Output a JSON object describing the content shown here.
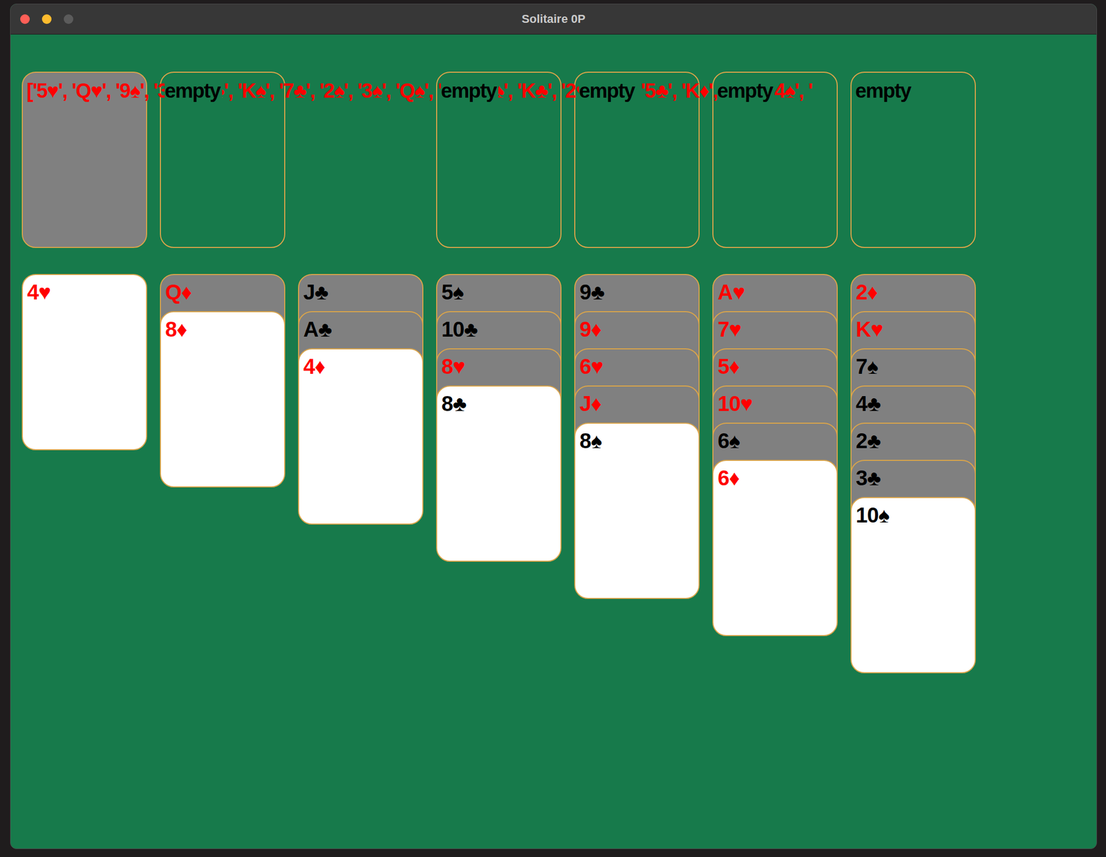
{
  "window": {
    "title": "Solitaire 0P",
    "controls": [
      {
        "name": "close",
        "color": "#ff5f57"
      },
      {
        "name": "minimize",
        "color": "#febc2e"
      },
      {
        "name": "zoom",
        "color": "#5b5b5b"
      }
    ]
  },
  "top_row": [
    {
      "kind": "stock",
      "label": "['5♥', 'Q♥', '9♠', '3♥', 'Q♣', 'K♠', '7♣', '2♠', '3♠', 'Q♠', 'J♠', 'A♠', 'K♣', '2♥', '6♣', '5♣', 'K♦', '10♦', '4♠', '"
    },
    {
      "kind": "slot",
      "label": "empty"
    },
    {
      "kind": "blank",
      "label": ""
    },
    {
      "kind": "slot",
      "label": "empty"
    },
    {
      "kind": "slot",
      "label": "empty"
    },
    {
      "kind": "slot",
      "label": "empty"
    },
    {
      "kind": "slot",
      "label": "empty"
    }
  ],
  "tableau": [
    [
      {
        "label": "4♥",
        "face_up": true,
        "color": "#ff0000"
      }
    ],
    [
      {
        "label": "Q♦",
        "face_up": false,
        "color": "#ff0000"
      },
      {
        "label": "8♦",
        "face_up": true,
        "color": "#ff0000"
      }
    ],
    [
      {
        "label": "J♣",
        "face_up": false,
        "color": "#000000"
      },
      {
        "label": "A♣",
        "face_up": false,
        "color": "#000000"
      },
      {
        "label": "4♦",
        "face_up": true,
        "color": "#ff0000"
      }
    ],
    [
      {
        "label": "5♠",
        "face_up": false,
        "color": "#000000"
      },
      {
        "label": "10♣",
        "face_up": false,
        "color": "#000000"
      },
      {
        "label": "8♥",
        "face_up": false,
        "color": "#ff0000"
      },
      {
        "label": "8♣",
        "face_up": true,
        "color": "#000000"
      }
    ],
    [
      {
        "label": "9♣",
        "face_up": false,
        "color": "#000000"
      },
      {
        "label": "9♦",
        "face_up": false,
        "color": "#ff0000"
      },
      {
        "label": "6♥",
        "face_up": false,
        "color": "#ff0000"
      },
      {
        "label": "J♦",
        "face_up": false,
        "color": "#ff0000"
      },
      {
        "label": "8♠",
        "face_up": true,
        "color": "#000000"
      }
    ],
    [
      {
        "label": "A♥",
        "face_up": false,
        "color": "#ff0000"
      },
      {
        "label": "7♥",
        "face_up": false,
        "color": "#ff0000"
      },
      {
        "label": "5♦",
        "face_up": false,
        "color": "#ff0000"
      },
      {
        "label": "10♥",
        "face_up": false,
        "color": "#ff0000"
      },
      {
        "label": "6♠",
        "face_up": false,
        "color": "#000000"
      },
      {
        "label": "6♦",
        "face_up": true,
        "color": "#ff0000"
      }
    ],
    [
      {
        "label": "2♦",
        "face_up": false,
        "color": "#ff0000"
      },
      {
        "label": "K♥",
        "face_up": false,
        "color": "#ff0000"
      },
      {
        "label": "7♠",
        "face_up": false,
        "color": "#000000"
      },
      {
        "label": "4♣",
        "face_up": false,
        "color": "#000000"
      },
      {
        "label": "2♣",
        "face_up": false,
        "color": "#000000"
      },
      {
        "label": "3♣",
        "face_up": false,
        "color": "#000000"
      },
      {
        "label": "10♠",
        "face_up": true,
        "color": "#000000"
      }
    ]
  ]
}
